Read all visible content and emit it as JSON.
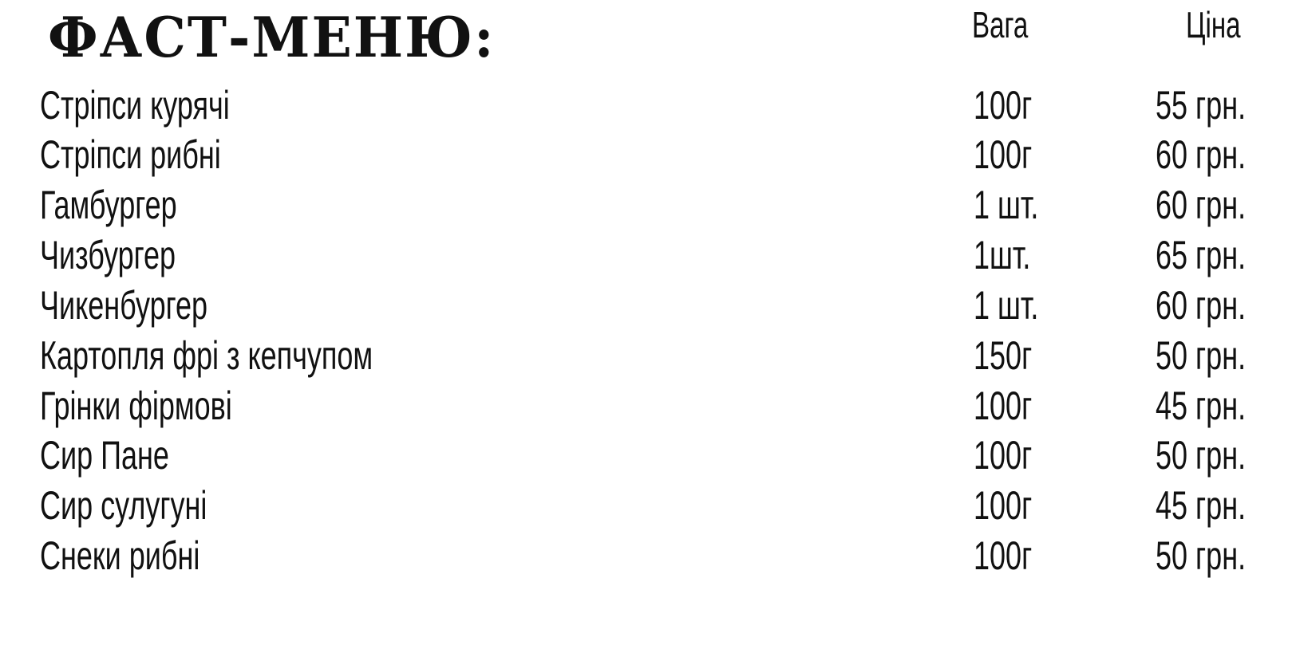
{
  "title": "ФАСТ-МЕНЮ:",
  "columns": {
    "weight": "Вага",
    "price": "Ціна"
  },
  "items": [
    {
      "name": "Стріпси курячі",
      "weight": "100г",
      "price": "55 грн."
    },
    {
      "name": "Стріпси рибні",
      "weight": "100г",
      "price": "60 грн."
    },
    {
      "name": "Гамбургер",
      "weight": "1 шт.",
      "price": "60 грн."
    },
    {
      "name": "Чизбургер",
      "weight": "1шт.",
      "price": "65 грн."
    },
    {
      "name": "Чикенбургер",
      "weight": "1 шт.",
      "price": "60 грн."
    },
    {
      "name": "Картопля фрі з кепчупом",
      "weight": "150г",
      "price": "50 грн."
    },
    {
      "name": "Грінки фірмові",
      "weight": "100г",
      "price": "45 грн."
    },
    {
      "name": "Сир Пане",
      "weight": "100г",
      "price": "50 грн."
    },
    {
      "name": "Сир сулугуні",
      "weight": "100г",
      "price": "45 грн."
    },
    {
      "name": "Снеки рибні",
      "weight": "100г",
      "price": "50 грн."
    }
  ]
}
